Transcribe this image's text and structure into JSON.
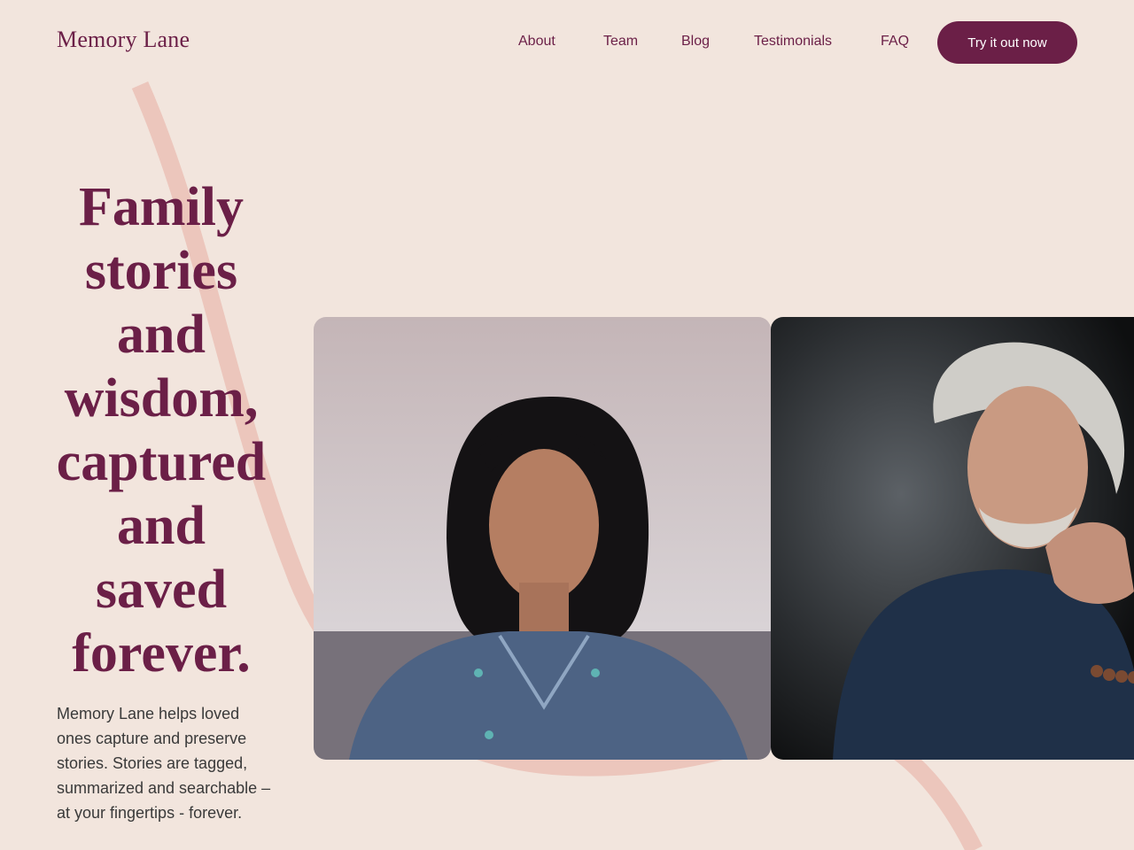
{
  "header": {
    "logo": "Memory Lane",
    "nav": [
      "About",
      "Team",
      "Blog",
      "Testimonials",
      "FAQ"
    ],
    "cta_label": "Try it out now"
  },
  "hero": {
    "title": "Family stories and wisdom, captured and saved forever.",
    "description": "Memory Lane helps loved ones capture and preserve stories. Stories are tagged, summarized and searchable – at your fingertips - forever."
  },
  "colors": {
    "background": "#f2e5dd",
    "brand": "#6b1f47",
    "decorative_curve": "#ecc6bc",
    "body_text": "#3a3a3a"
  },
  "images": [
    {
      "name": "portrait-woman-photo"
    },
    {
      "name": "portrait-man-photo"
    }
  ]
}
